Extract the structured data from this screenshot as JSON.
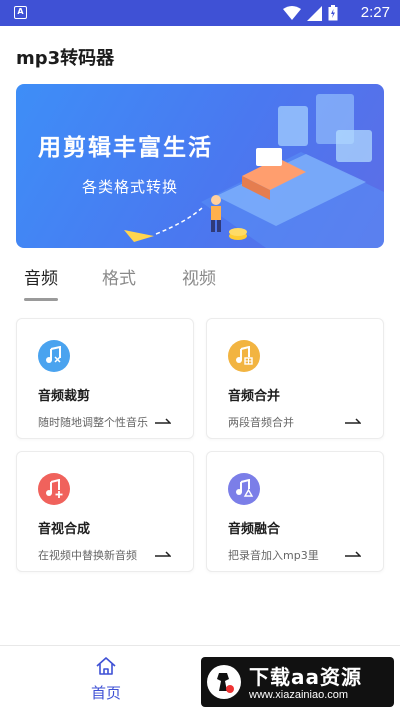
{
  "status_bar": {
    "time": "2:27",
    "background": "#3f51d5"
  },
  "app": {
    "title": "mp3转码器"
  },
  "banner": {
    "slogan": "用剪辑丰富生活",
    "subline": "各类格式转换"
  },
  "tabs": [
    {
      "label": "音频",
      "active": true
    },
    {
      "label": "格式",
      "active": false
    },
    {
      "label": "视频",
      "active": false
    }
  ],
  "cards": [
    {
      "title": "音频裁剪",
      "desc": "随时随地调整个性音乐",
      "icon": "music-cut-icon",
      "color": "#4aa3ef"
    },
    {
      "title": "音频合并",
      "desc": "两段音频合并",
      "icon": "music-merge-icon",
      "color": "#f2b441"
    },
    {
      "title": "音视合成",
      "desc": "在视频中替换新音频",
      "icon": "music-add-icon",
      "color": "#f0625c"
    },
    {
      "title": "音频融合",
      "desc": "把录音加入mp3里",
      "icon": "music-recycle-icon",
      "color": "#7b7ee8"
    }
  ],
  "bottom_nav": {
    "home_label": "首页",
    "accent": "#3f51d5"
  },
  "watermark": {
    "title": "下载aa资源",
    "url": "www.xiazainiao.com"
  }
}
